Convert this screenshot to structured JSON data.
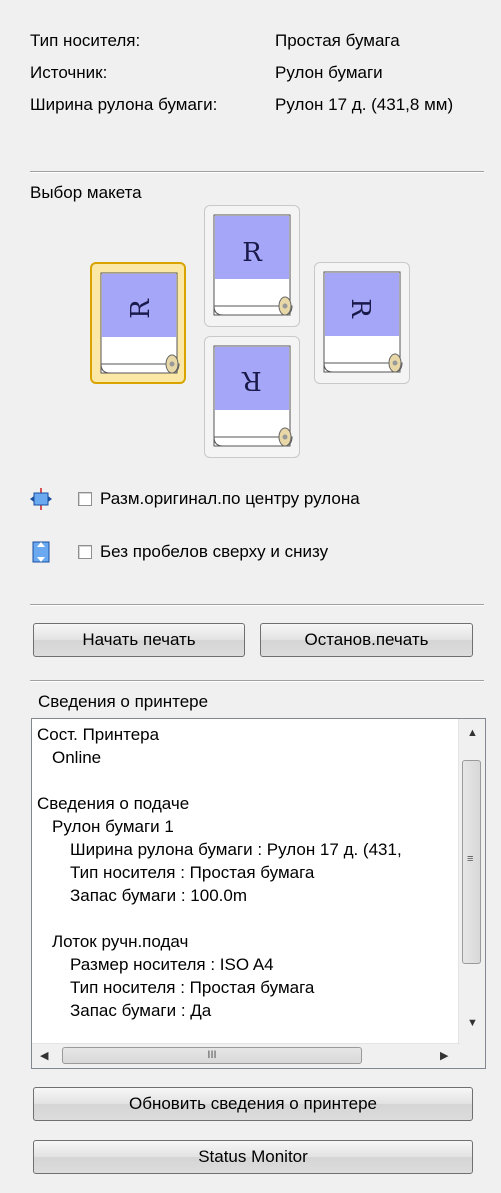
{
  "media_info": {
    "rows": [
      {
        "label": "Тип носителя:",
        "value": "Простая бумага"
      },
      {
        "label": "Источник:",
        "value": "Рулон бумаги"
      },
      {
        "label": "Ширина рулона бумаги:",
        "value": "Рулон 17 д. (431,8 мм)"
      }
    ]
  },
  "layout": {
    "title": "Выбор макета",
    "glyph": "R",
    "options": [
      {
        "name": "rotated-left",
        "selected": true
      },
      {
        "name": "normal",
        "selected": false
      },
      {
        "name": "upside-down",
        "selected": false
      },
      {
        "name": "rotated-right",
        "selected": false
      }
    ]
  },
  "options": {
    "center_label": "Разм.оригинал.по центру рулона",
    "center_checked": false,
    "noborder_label": "Без пробелов сверху и снизу",
    "noborder_checked": false
  },
  "buttons": {
    "start": "Начать печать",
    "stop": "Останов.печать",
    "refresh": "Обновить сведения о принтере",
    "status_monitor": "Status Monitor"
  },
  "printer_info": {
    "title": "Сведения о принтере",
    "lines": [
      "Сост. Принтера",
      "Online",
      "",
      "Сведения о подаче",
      "Рулон бумаги 1",
      "Ширина рулона бумаги : Рулон 17 д. (431,",
      "Тип носителя : Простая бумага",
      "Запас бумаги : 100.0m",
      "",
      "Лоток ручн.подач",
      "Размер носителя : ISO A4",
      "Тип носителя : Простая бумага",
      "Запас бумаги : Да"
    ],
    "scroll_grip": "III"
  },
  "colors": {
    "page_fill": "#a6a6f8",
    "selected_border": "#d9a400",
    "selected_fill": "#fbe8a6"
  }
}
